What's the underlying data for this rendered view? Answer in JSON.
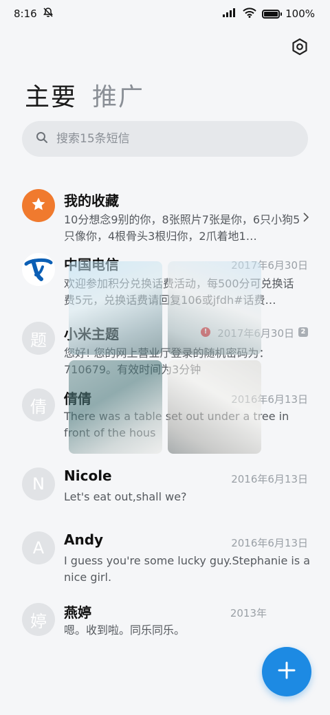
{
  "status_bar": {
    "time": "8:16",
    "battery": "100%",
    "battery_level": 1.0,
    "icons": [
      "bell-off-icon",
      "signal-icon",
      "wifi-icon",
      "battery-icon"
    ]
  },
  "header": {
    "settings_icon": "settings-hexagon-icon",
    "tabs": [
      {
        "label": "主要",
        "active": true
      },
      {
        "label": "推广",
        "active": false
      }
    ]
  },
  "search": {
    "placeholder": "搜索15条短信",
    "value": ""
  },
  "conversations": [
    {
      "name": "我的收藏",
      "date": "",
      "preview": "10分想念9别的你，8张照片7张是你，6只小狗5只像你，4根骨头3根归你，2爪着地1…",
      "avatar": "star-icon",
      "avatar_color": "#f07a2e"
    },
    {
      "name": "中国电信",
      "date": "2017年6月30日",
      "preview": "欢迎参加积分兑换话费活动，每500分可兑换话费5元，兑换话费请回复106或jfdh#话费…",
      "avatar": "china-telecom-logo",
      "avatar_color": "#0b5fb5"
    },
    {
      "name": "小米主题",
      "date": "2017年6月30日",
      "preview": "您好! 您的网上营业厅登录的随机密码为：710679。有效时间为3分钟",
      "avatar_letter": "题",
      "badge": "2",
      "error": "!"
    },
    {
      "name": "倩倩",
      "date": "2016年6月13日",
      "preview": "There was a table set out under a tree in front of the hous",
      "avatar_letter": "倩"
    },
    {
      "name": "Nicole",
      "date": "2016年6月13日",
      "preview": "Let's eat out,shall we?",
      "avatar_letter": "N"
    },
    {
      "name": "Andy",
      "date": "2016年6月13日",
      "preview": "I guess you're some lucky guy.Stephanie is a nice girl.",
      "avatar_letter": "A"
    },
    {
      "name": "燕婷",
      "date": "2013年",
      "preview": "嗯。收到啦。同乐同乐。",
      "avatar_letter": "婷"
    }
  ],
  "fab": {
    "icon": "plus-icon",
    "color": "#1d8ae3"
  }
}
